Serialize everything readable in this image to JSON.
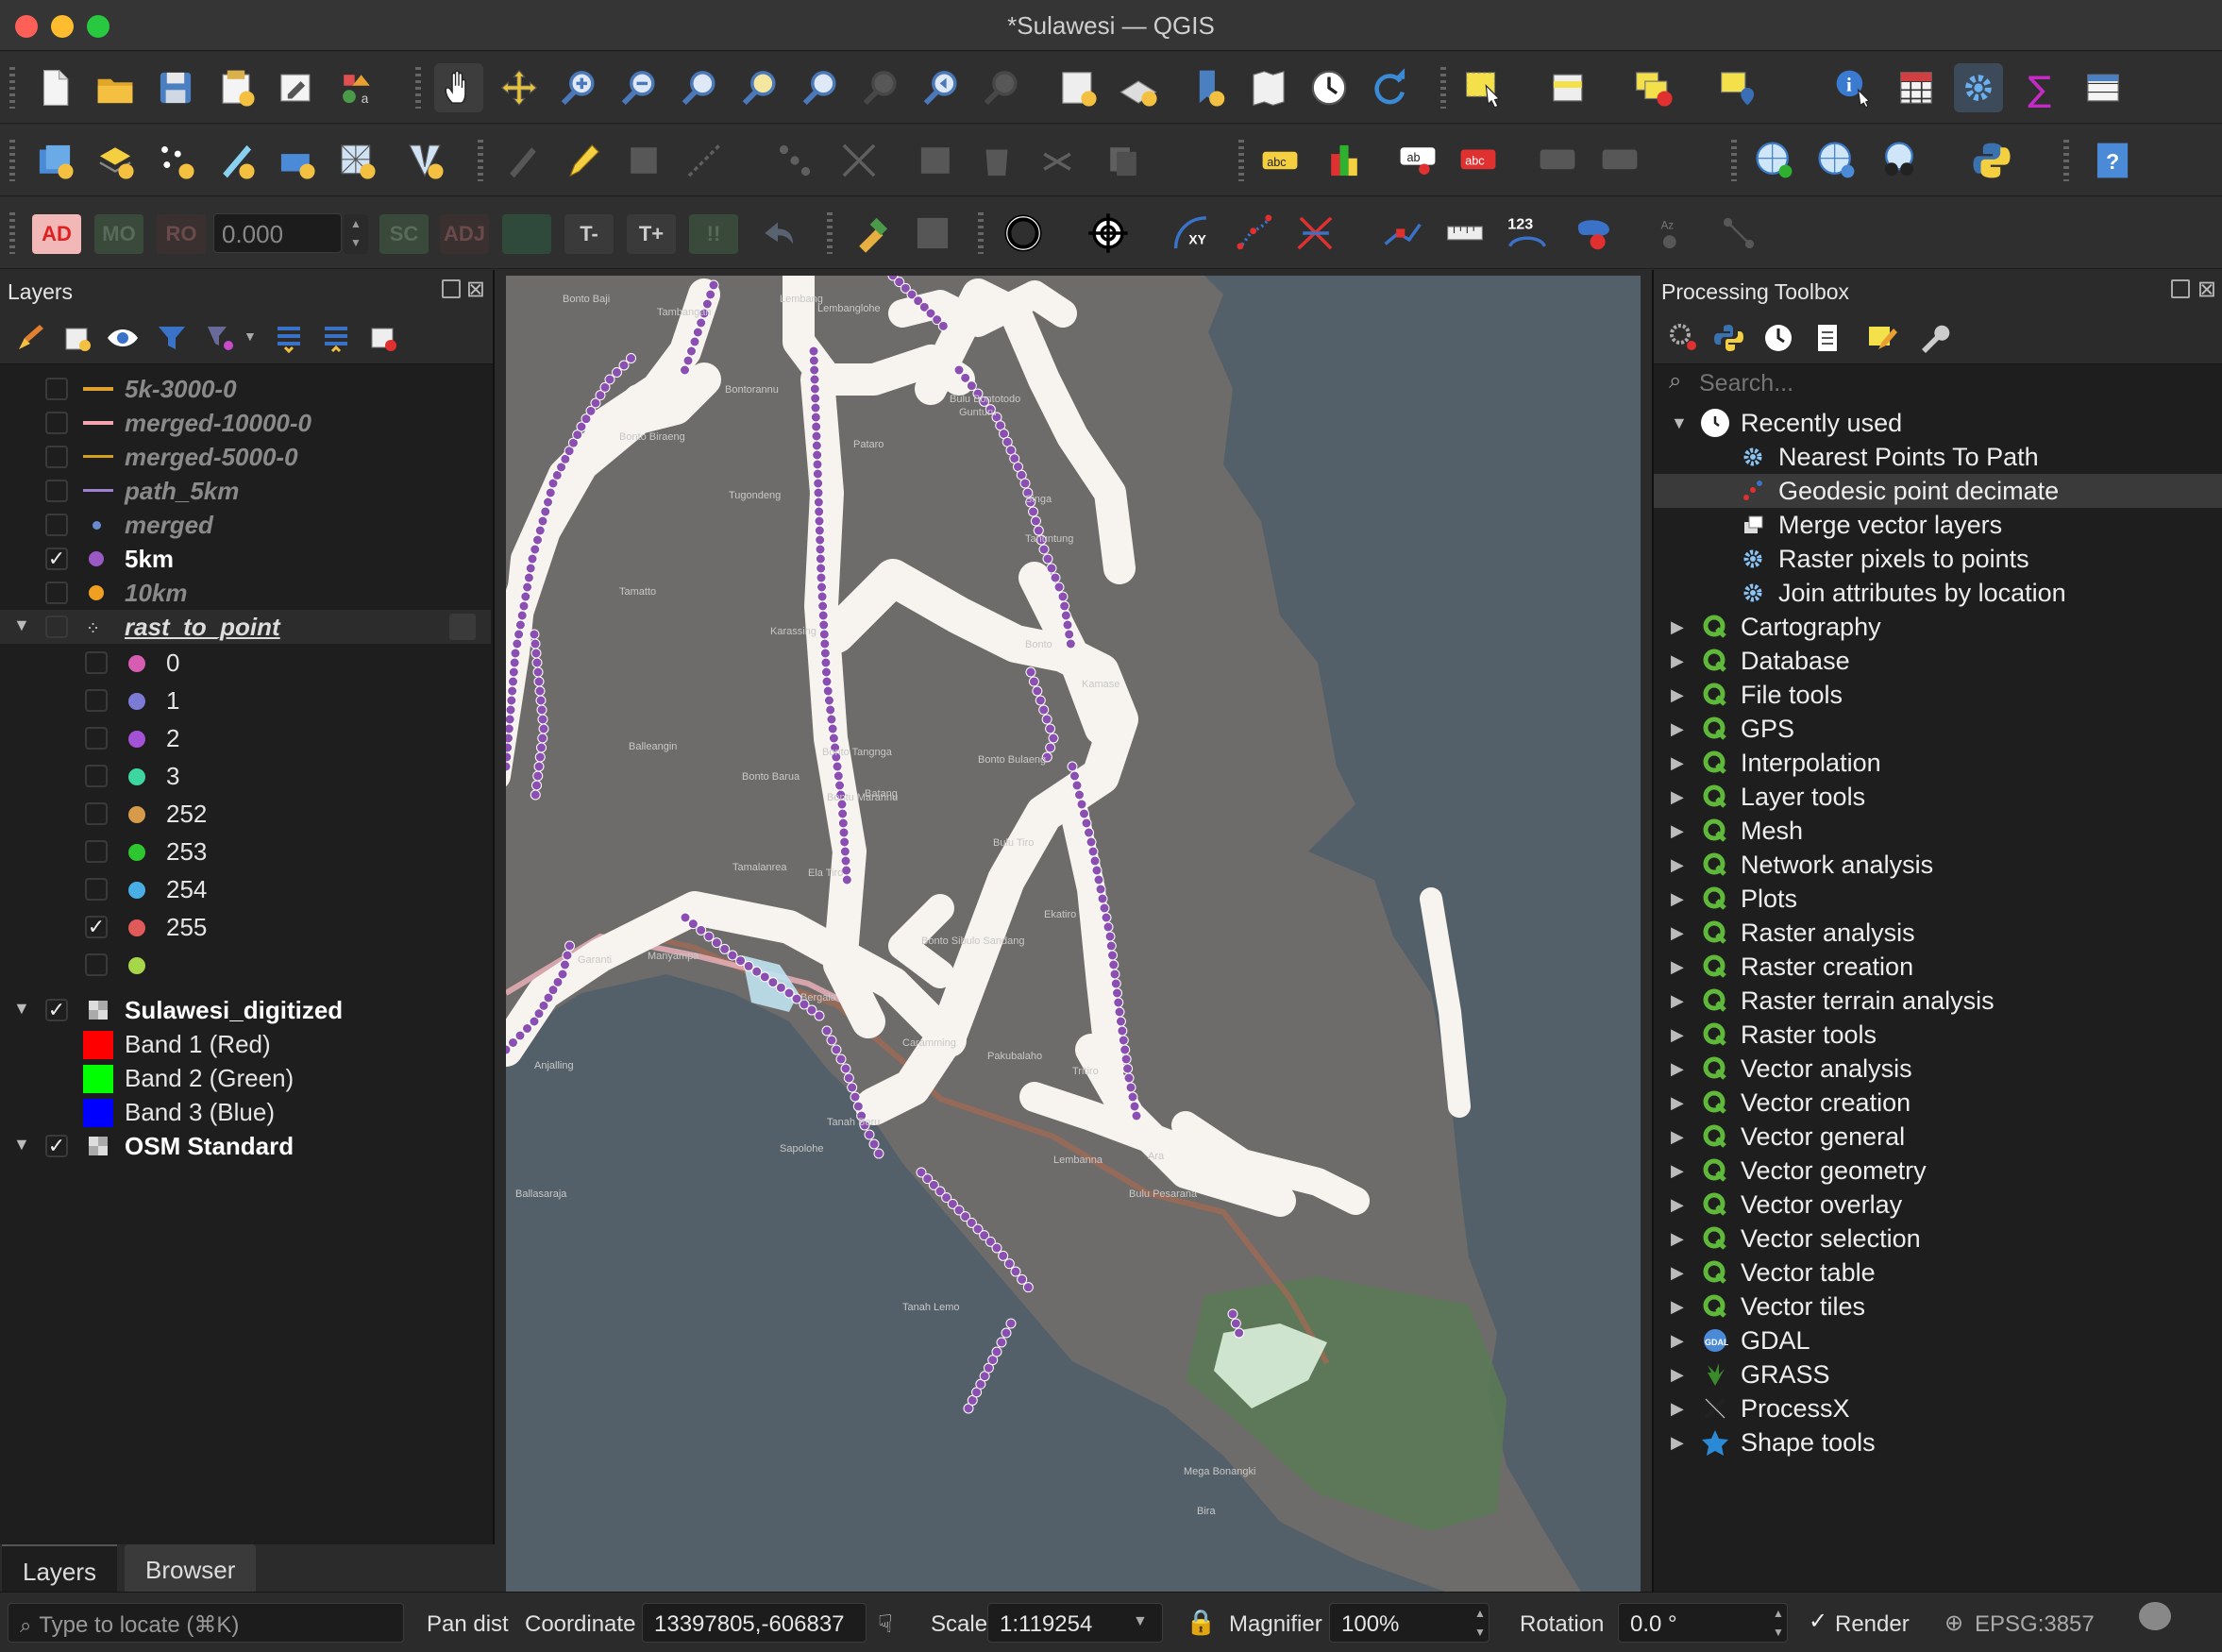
{
  "window": {
    "title": "*Sulawesi — QGIS"
  },
  "advanced_digitizing": {
    "ad": "AD",
    "mo": "MO",
    "ro": "RO",
    "value": "0.000",
    "sc": "SC",
    "adj": "ADJ",
    "t_minus": "T-",
    "t_plus": "T+"
  },
  "toolbar_labels": {
    "abc": "abc",
    "ab": "ab",
    "num": "123"
  },
  "colors": {
    "accent_selected": "#3a3a3a",
    "point_purple": "#8a4fb0",
    "map_land": "#6e6c6a",
    "map_sea": "#536069",
    "forest": "#5a7a55"
  },
  "layers_panel": {
    "title": "Layers",
    "items": [
      {
        "label": "5k-3000-0",
        "checked": false,
        "symbol": "line",
        "color": "#e0a030"
      },
      {
        "label": "merged-10000-0",
        "checked": false,
        "symbol": "line",
        "color": "#f4a5b0"
      },
      {
        "label": "merged-5000-0",
        "checked": false,
        "symbol": "line",
        "color": "#d4a020"
      },
      {
        "label": "path_5km",
        "checked": false,
        "symbol": "line",
        "color": "#a080d0"
      },
      {
        "label": "merged",
        "checked": false,
        "symbol": "dot-small",
        "color": "#6a8ad0"
      },
      {
        "label": "5km",
        "checked": true,
        "symbol": "dot",
        "color": "#9b59c6"
      },
      {
        "label": "10km",
        "checked": false,
        "symbol": "dot",
        "color": "#f0a020"
      },
      {
        "label": "rast_to_point",
        "checked": false,
        "symbol": "points"
      }
    ],
    "classes": [
      {
        "label": "0",
        "checked": false,
        "color": "#d65db1"
      },
      {
        "label": "1",
        "checked": false,
        "color": "#7b7bd6"
      },
      {
        "label": "2",
        "checked": false,
        "color": "#a352d6"
      },
      {
        "label": "3",
        "checked": false,
        "color": "#3ed6a0"
      },
      {
        "label": "252",
        "checked": false,
        "color": "#d69a4a"
      },
      {
        "label": "253",
        "checked": false,
        "color": "#2fc72f"
      },
      {
        "label": "254",
        "checked": false,
        "color": "#4aaee6"
      },
      {
        "label": "255",
        "checked": true,
        "color": "#e05a5a"
      },
      {
        "label": "",
        "checked": false,
        "color": "#a6d64a"
      }
    ],
    "raster": {
      "label": "Sulawesi_digitized",
      "checked": true,
      "bands": [
        {
          "label": "Band 1 (Red)",
          "color": "#ff0000"
        },
        {
          "label": "Band 2 (Green)",
          "color": "#00ff00"
        },
        {
          "label": "Band 3 (Blue)",
          "color": "#0000ff"
        }
      ]
    },
    "basemap": {
      "label": "OSM Standard",
      "checked": true
    }
  },
  "left_tabs": [
    {
      "label": "Layers"
    },
    {
      "label": "Browser"
    }
  ],
  "map": {
    "labels": [
      "Bonto Baji",
      "Lembang",
      "Lembanglohe",
      "Tambangan",
      "Bontorannu",
      "Bulu Bontotodo",
      "Gunturu",
      "Bonto Biraeng",
      "Pataro",
      "Tugondeng",
      "Singa",
      "Tanuntung",
      "Tamatto",
      "Karassing",
      "Bonto",
      "Kamase",
      "Balleangin",
      "Bonto Barua",
      "Bonto Tangnga",
      "Bonto Bulaeng",
      "Batang",
      "Bontu Marannu",
      "Tamalanrea",
      "Ela Tiro",
      "Bulu Tiro",
      "Ekatiro",
      "Bonto Sibulo Sandang",
      "Garanti",
      "Manyampa",
      "Bergala",
      "Caramming",
      "Pakubalaho",
      "Tritiro",
      "Anjalling",
      "Tanah Beru",
      "Sapolohe",
      "Lembanna",
      "Bulu Pesarana",
      "Ara",
      "Ballasaraja",
      "Tanah Lemo",
      "Mega Bonangki",
      "Bira"
    ]
  },
  "processing_toolbox": {
    "title": "Processing Toolbox",
    "search_placeholder": "Search...",
    "recently_used_label": "Recently used",
    "recent": [
      {
        "label": "Nearest Points To Path",
        "icon": "gear-icon"
      },
      {
        "label": "Geodesic point decimate",
        "icon": "points-icon",
        "selected": true
      },
      {
        "label": "Merge vector layers",
        "icon": "merge-icon"
      },
      {
        "label": "Raster pixels to points",
        "icon": "gear-icon"
      },
      {
        "label": "Join attributes by location",
        "icon": "gear-icon"
      }
    ],
    "providers": [
      {
        "label": "Cartography",
        "icon": "qgis-icon"
      },
      {
        "label": "Database",
        "icon": "qgis-icon"
      },
      {
        "label": "File tools",
        "icon": "qgis-icon"
      },
      {
        "label": "GPS",
        "icon": "qgis-icon"
      },
      {
        "label": "Interpolation",
        "icon": "qgis-icon"
      },
      {
        "label": "Layer tools",
        "icon": "qgis-icon"
      },
      {
        "label": "Mesh",
        "icon": "qgis-icon"
      },
      {
        "label": "Network analysis",
        "icon": "qgis-icon"
      },
      {
        "label": "Plots",
        "icon": "qgis-icon"
      },
      {
        "label": "Raster analysis",
        "icon": "qgis-icon"
      },
      {
        "label": "Raster creation",
        "icon": "qgis-icon"
      },
      {
        "label": "Raster terrain analysis",
        "icon": "qgis-icon"
      },
      {
        "label": "Raster tools",
        "icon": "qgis-icon"
      },
      {
        "label": "Vector analysis",
        "icon": "qgis-icon"
      },
      {
        "label": "Vector creation",
        "icon": "qgis-icon"
      },
      {
        "label": "Vector general",
        "icon": "qgis-icon"
      },
      {
        "label": "Vector geometry",
        "icon": "qgis-icon"
      },
      {
        "label": "Vector overlay",
        "icon": "qgis-icon"
      },
      {
        "label": "Vector selection",
        "icon": "qgis-icon"
      },
      {
        "label": "Vector table",
        "icon": "qgis-icon"
      },
      {
        "label": "Vector tiles",
        "icon": "qgis-icon"
      },
      {
        "label": "GDAL",
        "icon": "gdal-icon"
      },
      {
        "label": "GRASS",
        "icon": "grass-icon"
      },
      {
        "label": "ProcessX",
        "icon": "processx-icon"
      },
      {
        "label": "Shape tools",
        "icon": "star-icon"
      }
    ]
  },
  "statusbar": {
    "locate_placeholder": "Type to locate (⌘K)",
    "pan_dist": "Pan dist",
    "coordinate_label": "Coordinate",
    "coordinate": "13397805,-606837",
    "scale_label": "Scale",
    "scale": "1:119254",
    "magnifier_label": "Magnifier",
    "magnifier": "100%",
    "rotation_label": "Rotation",
    "rotation": "0.0 °",
    "render_label": "Render",
    "render_checked": true,
    "crs": "EPSG:3857"
  }
}
